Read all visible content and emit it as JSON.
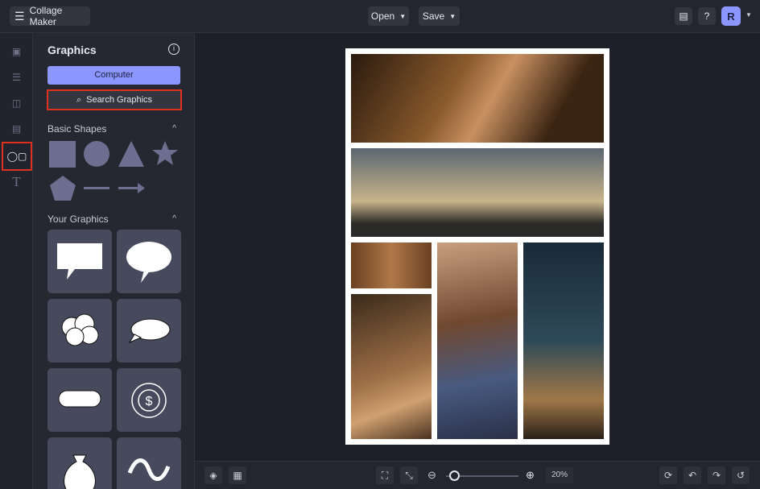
{
  "header": {
    "menu_label": "Collage Maker",
    "open_label": "Open",
    "save_label": "Save",
    "avatar_initial": "R"
  },
  "panel": {
    "title": "Graphics",
    "computer_label": "Computer",
    "search_label": "Search Graphics",
    "basic_shapes_label": "Basic Shapes",
    "your_graphics_label": "Your Graphics"
  },
  "rail": [
    "image-icon",
    "adjust-icon",
    "layout-icon",
    "texture-icon",
    "graphics-icon",
    "text-icon"
  ],
  "zoom": {
    "value": "20%",
    "level": 0.2
  },
  "colors": {
    "accent": "#8b97ff",
    "highlight": "#e0301e"
  }
}
